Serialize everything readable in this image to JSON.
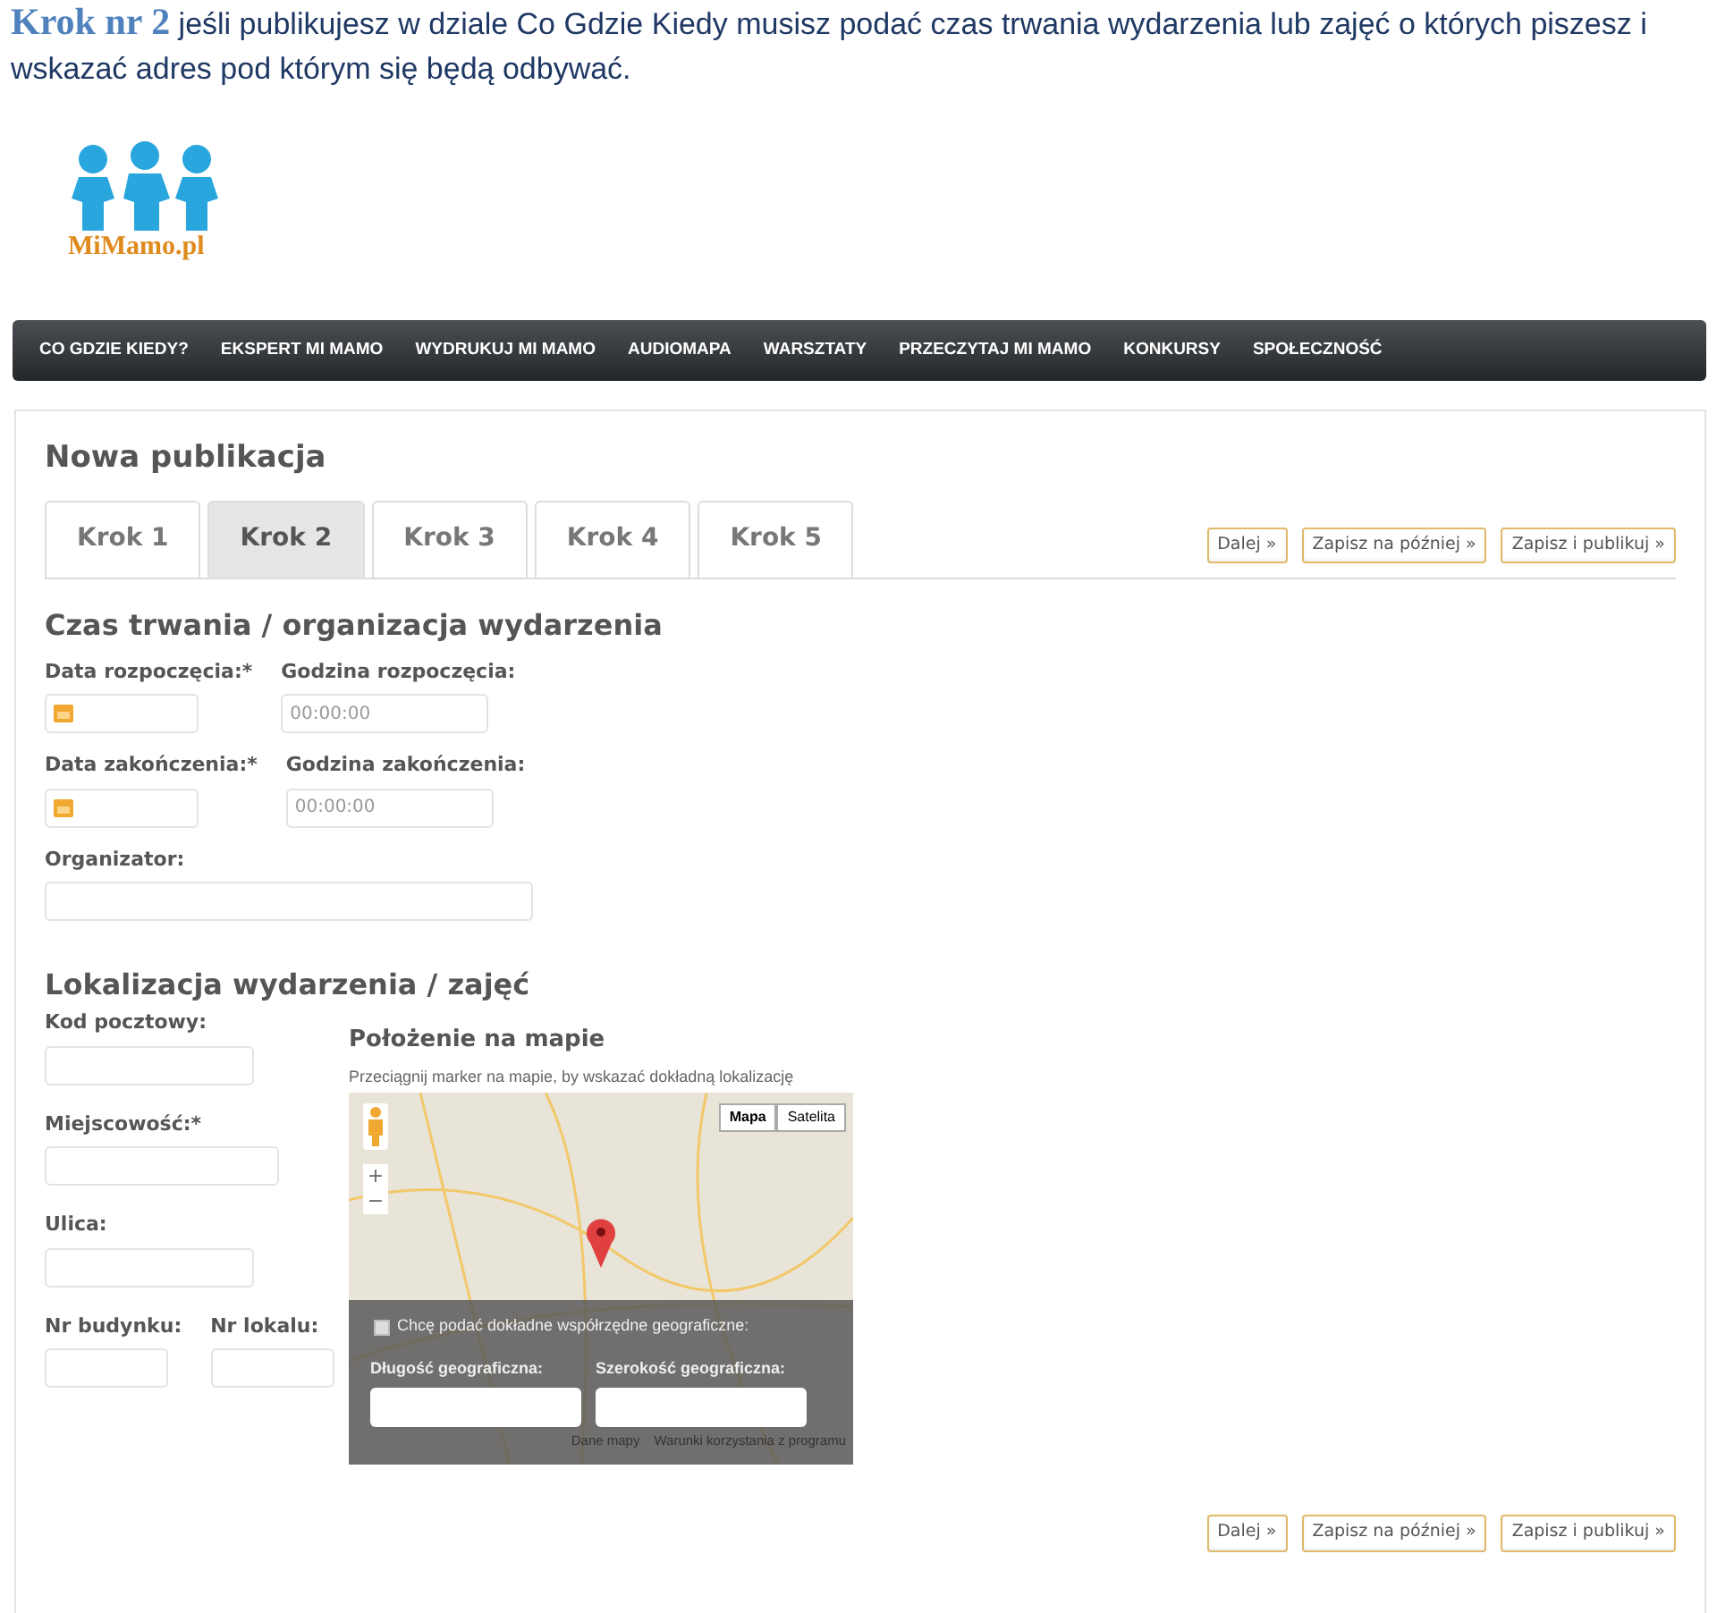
{
  "intro": {
    "title": "Krok nr 2",
    "text": "jeśli publikujesz w dziale Co Gdzie Kiedy musisz podać czas trwania wydarzenia lub zajęć o których piszesz i wskazać adres pod którym się będą odbywać."
  },
  "logo": {
    "text": "MiMamo.pl"
  },
  "nav": [
    "CO GDZIE KIEDY?",
    "EKSPERT MI MAMO",
    "WYDRUKUJ MI MAMO",
    "AUDIOMAPA",
    "WARSZTATY",
    "PRZECZYTAJ MI MAMO",
    "KONKURSY",
    "SPOŁECZNOŚĆ"
  ],
  "panel": {
    "title": "Nowa publikacja",
    "tabs": [
      {
        "label": "Krok 1",
        "selected": false
      },
      {
        "label": "Krok 2",
        "selected": true
      },
      {
        "label": "Krok 3",
        "selected": false
      },
      {
        "label": "Krok 4",
        "selected": false
      },
      {
        "label": "Krok 5",
        "selected": false
      }
    ],
    "actions": [
      "Dalej »",
      "Zapisz na później »",
      "Zapisz i publikuj »"
    ],
    "time_section": {
      "heading": "Czas trwania / organizacja wydarzenia",
      "rows": [
        [
          {
            "label": "Data rozpoczęcia:*",
            "kind": "date"
          },
          {
            "label": "Godzina rozpoczęcia:",
            "kind": "time",
            "placeholder": "00:00:00"
          }
        ],
        [
          {
            "label": "Data zakończenia:*",
            "kind": "date"
          },
          {
            "label": "Godzina zakończenia:",
            "kind": "time",
            "placeholder": "00:00:00"
          }
        ],
        [
          {
            "label": "Organizator:",
            "kind": "wide"
          }
        ]
      ]
    },
    "location_section": {
      "heading": "Lokalizacja wydarzenia / zajęć",
      "rows": [
        [
          {
            "label": "Kod pocztowy:",
            "kind": "medium"
          }
        ],
        [
          {
            "label": "Miejscowość:*",
            "kind": "long"
          }
        ],
        [
          {
            "label": "Ulica:",
            "kind": "medium"
          }
        ],
        [
          {
            "label": "Nr budynku:",
            "kind": "short"
          },
          {
            "label": "Nr lokalu:",
            "kind": "short"
          }
        ]
      ],
      "map": {
        "title": "Położenie na mapie",
        "hint": "Przeciągnij marker na mapie, by wskazać dokładną lokalizację",
        "map_types": [
          {
            "label": "Mapa",
            "selected": true
          },
          {
            "label": "Satelita",
            "selected": false
          }
        ],
        "zoom": [
          "+",
          "−"
        ],
        "coords_checkbox": {
          "label": "Chcę podać dokładne współrzędne geograficzne:",
          "checked": false
        },
        "coord_fields": [
          "Długość geograficzna:",
          "Szerokość geograficzna:"
        ],
        "attribution": [
          "Dane mapy",
          "Warunki korzystania z programu"
        ]
      }
    },
    "bottom_actions": [
      "Dalej »",
      "Zapisz na później »",
      "Zapisz i publikuj »"
    ]
  }
}
